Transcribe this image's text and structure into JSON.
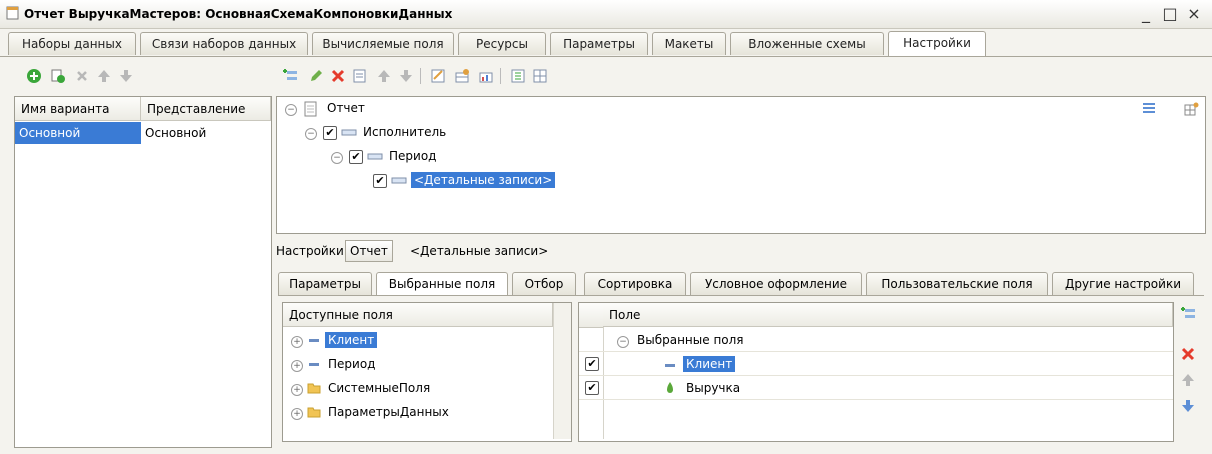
{
  "window": {
    "title": "Отчет ВыручкаМастеров: ОсновнаяСхемаКомпоновкиДанных",
    "minimize": "_",
    "maximize": "□",
    "close": "×"
  },
  "top_tabs": [
    {
      "label": "Наборы данных"
    },
    {
      "label": "Связи наборов данных"
    },
    {
      "label": "Вычисляемые поля"
    },
    {
      "label": "Ресурсы"
    },
    {
      "label": "Параметры"
    },
    {
      "label": "Макеты"
    },
    {
      "label": "Вложенные схемы"
    },
    {
      "label": "Настройки",
      "active": true
    }
  ],
  "variants": {
    "columns": [
      "Имя варианта",
      "Представление"
    ],
    "rows": [
      [
        "Основной",
        "Основной"
      ]
    ]
  },
  "structure_tree": {
    "root": "Отчет",
    "level1": "Исполнитель",
    "level2": "Период",
    "level3": "<Детальные записи>"
  },
  "settings_bar": {
    "label": "Настройки:",
    "button": "Отчет",
    "current": "<Детальные записи>"
  },
  "bottom_tabs": [
    {
      "label": "Параметры"
    },
    {
      "label": "Выбранные поля",
      "active": true
    },
    {
      "label": "Отбор"
    },
    {
      "label": "Сортировка"
    },
    {
      "label": "Условное оформление"
    },
    {
      "label": "Пользовательские поля"
    },
    {
      "label": "Другие настройки"
    }
  ],
  "available_fields": {
    "header": "Доступные поля",
    "items": [
      "Клиент",
      "Период",
      "СистемныеПоля",
      "ПараметрыДанных"
    ]
  },
  "selected_fields": {
    "header": "Поле",
    "group": "Выбранные поля",
    "items": [
      "Клиент",
      "Выручка"
    ]
  },
  "colors": {
    "accent": "#3a7bd5",
    "delete": "#e53b2c",
    "add": "#3aa63a",
    "arrow": "#5d8fd6"
  }
}
